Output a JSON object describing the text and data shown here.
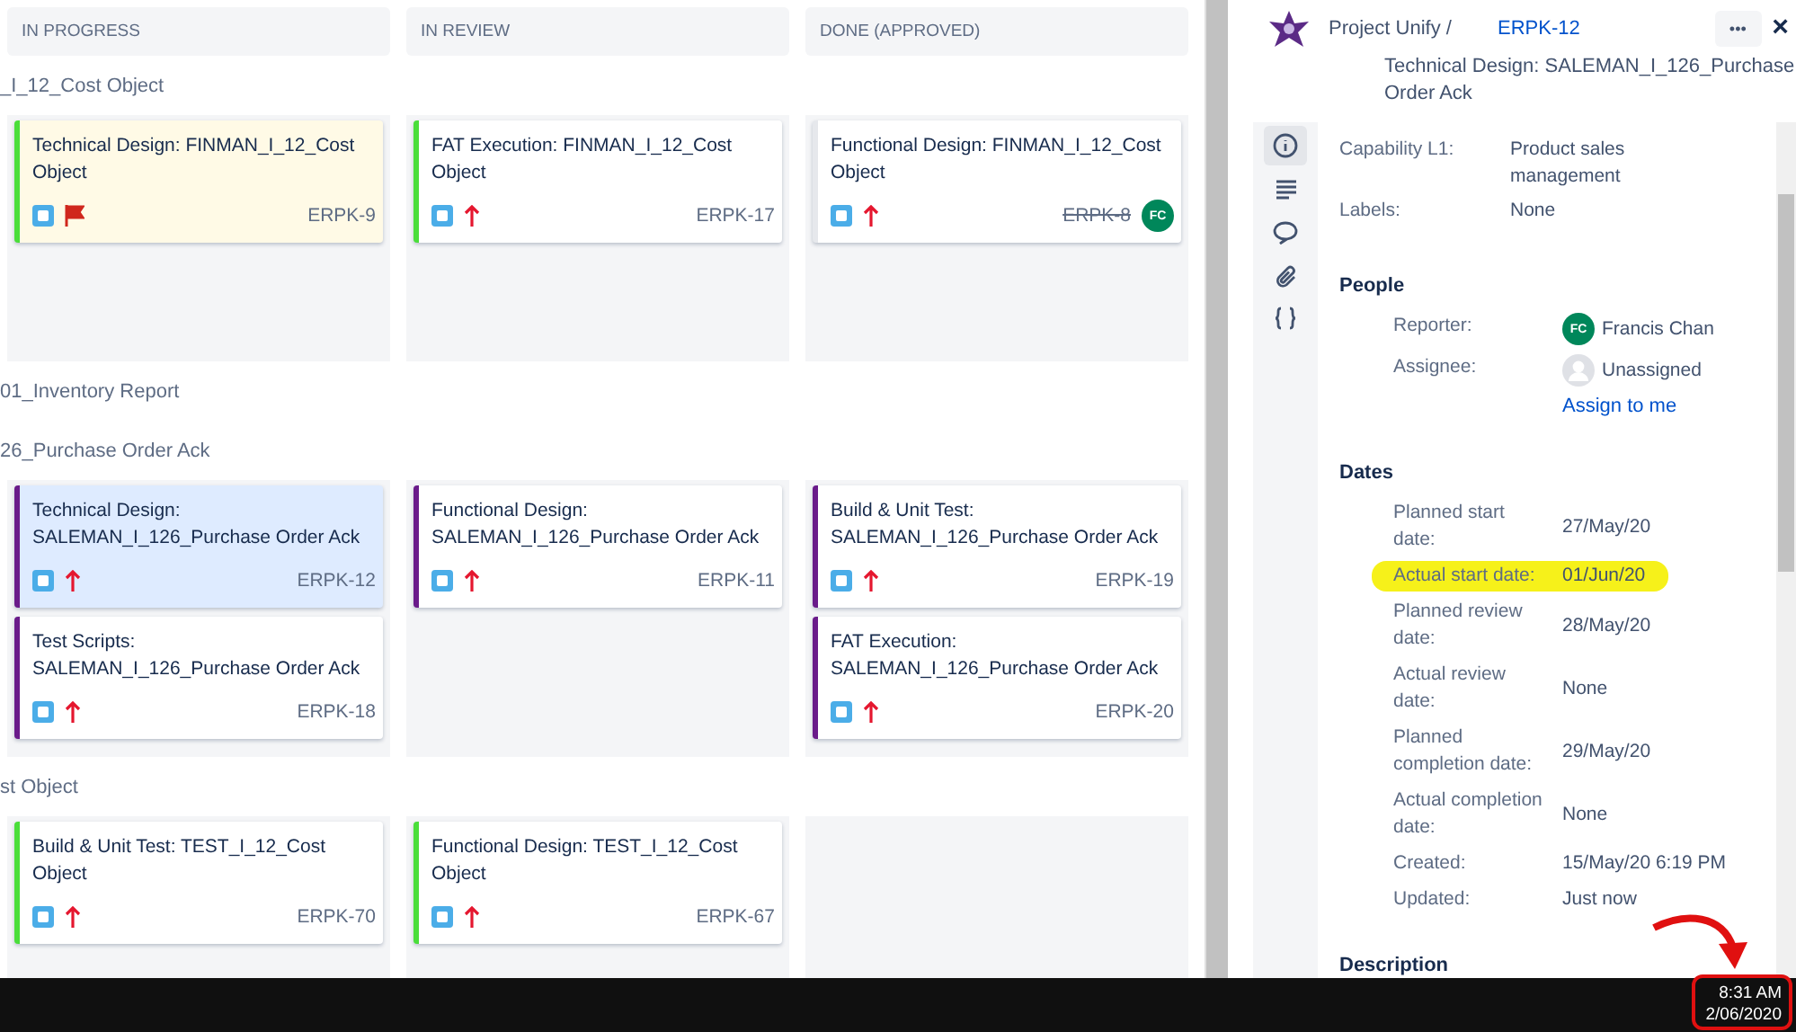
{
  "board": {
    "columns": [
      {
        "title": "IN PROGRESS"
      },
      {
        "title": "IN REVIEW"
      },
      {
        "title": "DONE (APPROVED)"
      }
    ],
    "swimlanes": [
      {
        "title": "_I_12_Cost Object",
        "cells": [
          [
            {
              "title": "Technical Design: FINMAN_I_12_Cost Object",
              "key": "ERPK-9",
              "kind": "flag",
              "color": "#4ade3a",
              "flagged": true,
              "selected": false,
              "done": false
            }
          ],
          [
            {
              "title": "FAT Execution: FINMAN_I_12_Cost Object",
              "key": "ERPK-17",
              "kind": "high",
              "color": "#4ade3a",
              "flagged": false,
              "selected": false,
              "done": false
            }
          ],
          [
            {
              "title": "Functional Design: FINMAN_I_12_Cost Object",
              "key": "ERPK-8",
              "kind": "high",
              "color": "#e6e8ec",
              "flagged": false,
              "selected": false,
              "done": true,
              "assignee": "FC"
            }
          ]
        ]
      },
      {
        "title": "01_Inventory Report"
      },
      {
        "title": "26_Purchase Order Ack",
        "cells": [
          [
            {
              "title": "Technical Design: SALEMAN_I_126_Purchase Order Ack",
              "key": "ERPK-12",
              "kind": "high",
              "color": "#6a1b8a",
              "flagged": false,
              "selected": true,
              "done": false
            },
            {
              "title": "Test Scripts: SALEMAN_I_126_Purchase Order Ack",
              "key": "ERPK-18",
              "kind": "high",
              "color": "#6a1b8a",
              "flagged": false,
              "selected": false,
              "done": false
            }
          ],
          [
            {
              "title": "Functional Design: SALEMAN_I_126_Purchase Order Ack",
              "key": "ERPK-11",
              "kind": "high",
              "color": "#6a1b8a",
              "flagged": false,
              "selected": false,
              "done": false
            }
          ],
          [
            {
              "title": "Build & Unit Test: SALEMAN_I_126_Purchase Order Ack",
              "key": "ERPK-19",
              "kind": "high",
              "color": "#6a1b8a",
              "flagged": false,
              "selected": false,
              "done": false
            },
            {
              "title": "FAT Execution: SALEMAN_I_126_Purchase Order Ack",
              "key": "ERPK-20",
              "kind": "high",
              "color": "#6a1b8a",
              "flagged": false,
              "selected": false,
              "done": false
            }
          ]
        ]
      },
      {
        "title": "st Object",
        "cells": [
          [
            {
              "title": "Build & Unit Test: TEST_I_12_Cost Object",
              "key": "ERPK-70",
              "kind": "high",
              "color": "#4ade3a",
              "flagged": false,
              "selected": false,
              "done": false
            }
          ],
          [
            {
              "title": "Functional Design: TEST_I_12_Cost Object",
              "key": "ERPK-67",
              "kind": "high",
              "color": "#4ade3a",
              "flagged": false,
              "selected": false,
              "done": false
            }
          ],
          []
        ]
      }
    ]
  },
  "detail": {
    "project": "Project Unify /",
    "key": "ERPK-12",
    "more": "•••",
    "close": "×",
    "title": "Technical Design: SALEMAN_I_126_Purchase Order Ack",
    "nav": [
      {
        "selected": true
      },
      {
        "selected": false
      },
      {
        "selected": false
      },
      {
        "selected": false
      },
      {
        "selected": false
      }
    ],
    "fields": [
      {
        "label": "Capability L1:",
        "value": "Product sales management"
      },
      {
        "label": "Labels:",
        "value": "None"
      }
    ],
    "sections": [
      {
        "heading": "People",
        "rows": [
          {
            "label": "Reporter:",
            "value": "Francis Chan",
            "avatar": "FC"
          },
          {
            "label": "Assignee:",
            "value": "Unassigned",
            "kind": "unassigned",
            "link": "Assign to me"
          }
        ]
      },
      {
        "heading": "Dates",
        "rows": [
          {
            "label": "Planned start date:",
            "value": "27/May/20",
            "highlighted": false
          },
          {
            "label": "Actual start date:",
            "value": "01/Jun/20",
            "highlighted": true
          },
          {
            "label": "Planned review date:",
            "value": "28/May/20",
            "highlighted": false
          },
          {
            "label": "Actual review date:",
            "value": "None",
            "highlighted": false
          },
          {
            "label": "Planned completion date:",
            "value": "29/May/20",
            "highlighted": false
          },
          {
            "label": "Actual completion date:",
            "value": "None",
            "highlighted": false
          },
          {
            "label": "Created:",
            "value": "15/May/20 6:19 PM",
            "highlighted": false
          },
          {
            "label": "Updated:",
            "value": "Just now",
            "highlighted": false
          }
        ]
      },
      {
        "heading": "Description"
      }
    ]
  },
  "taskbar": {
    "time": "8:31 AM",
    "date": "2/06/2020"
  }
}
